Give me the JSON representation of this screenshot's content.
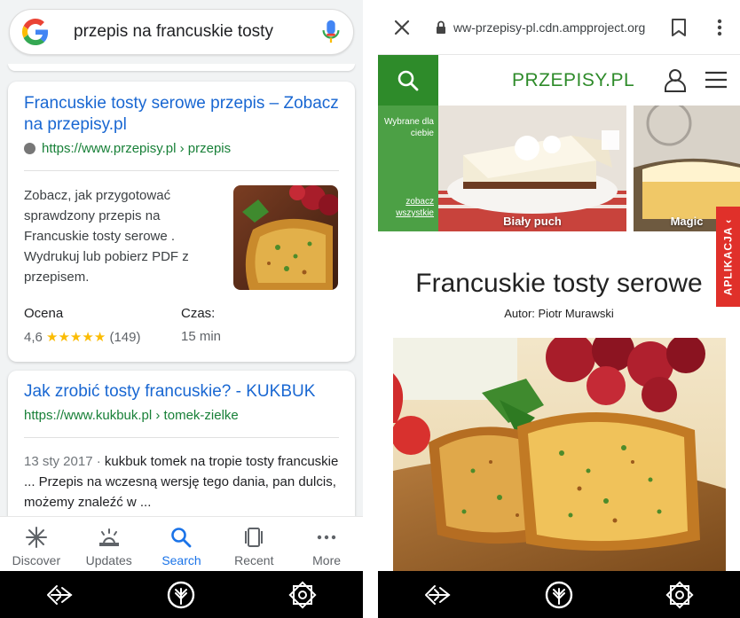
{
  "google": {
    "query": "przepis na francuskie tosty",
    "results": [
      {
        "title": "Francuskie tosty serowe przepis – Zobacz na przepisy.pl",
        "url": "https://www.przepisy.pl › przepis",
        "snippet": "Zobacz, jak przygotować sprawdzony przepis na Francuskie tosty serowe . Wydrukuj lub pobierz PDF z przepisem.",
        "rating_label": "Ocena",
        "rating_value": "4,6",
        "rating": 4.6,
        "rating_stars": "★★★★★",
        "rating_count": "(149)",
        "time_label": "Czas:",
        "time_value": "15 min"
      },
      {
        "title": "Jak zrobić tosty francuskie? - KUKBUK",
        "url": "https://www.kukbuk.pl › tomek-zielke",
        "date": "13 sty 2017 · ",
        "snippet": "kukbuk tomek na tropie tosty francuskie ... Przepis na wczesną wersję tego dania, pan dulcis, możemy znaleźć w ..."
      }
    ],
    "nav": [
      {
        "label": "Discover",
        "icon": "asterisk-icon"
      },
      {
        "label": "Updates",
        "icon": "updates-icon"
      },
      {
        "label": "Search",
        "icon": "search-icon",
        "active": true
      },
      {
        "label": "Recent",
        "icon": "recent-icon"
      },
      {
        "label": "More",
        "icon": "more-dots-icon"
      }
    ]
  },
  "browser": {
    "url": "ww-przepisy-pl.cdn.ampproject.org",
    "site": {
      "brand": "PRZEPISY.PL",
      "picked_for_you": "Wybrane dla ciebie",
      "see_all": "zobacz wszystkie",
      "tiles": [
        "Biały puch",
        "Magic"
      ],
      "app_tab": "APLIKACJA ‹",
      "recipe_title": "Francuskie tosty serowe",
      "author": "Autor: Piotr Murawski"
    }
  },
  "colors": {
    "link_blue": "#1967d2",
    "url_green": "#188038",
    "brand_green": "#2e8b2a",
    "star_yellow": "#fbbc04",
    "app_red": "#e0302a"
  }
}
